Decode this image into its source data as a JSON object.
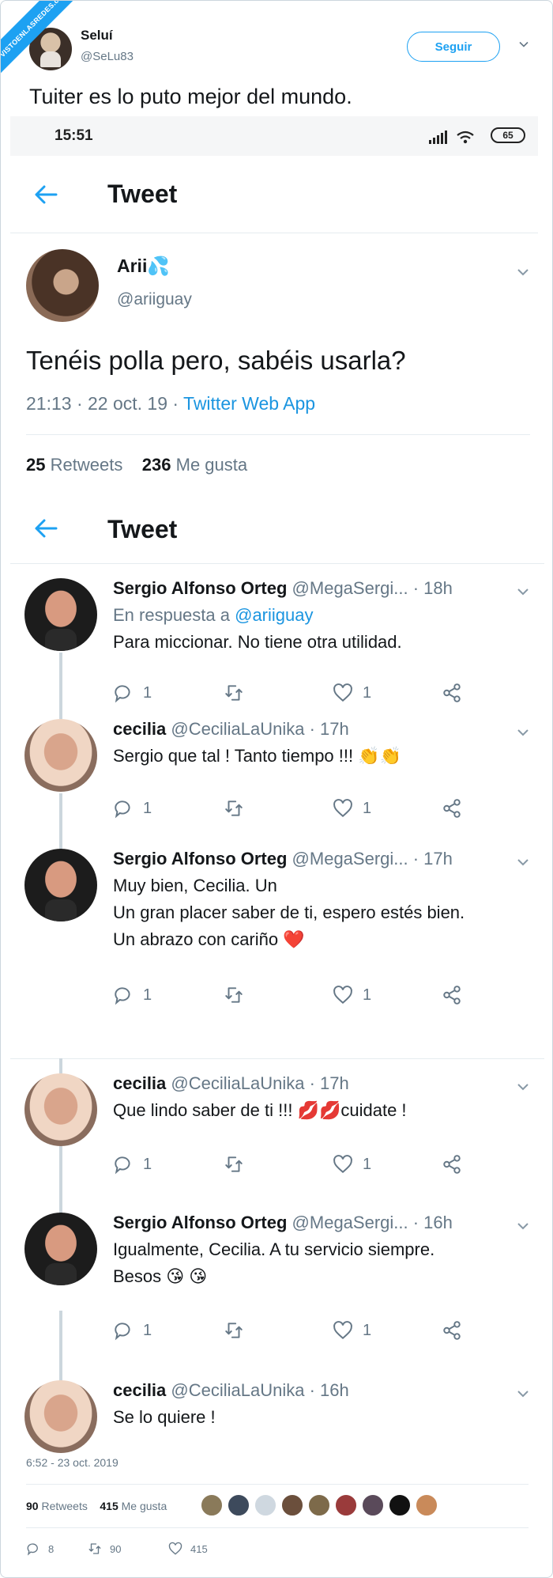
{
  "watermark": "VISTOENLASREDES.com",
  "outer": {
    "author_name": "Seluí",
    "author_handle": "@SeLu83",
    "follow_label": "Seguir",
    "tweet_text": "Tuiter es lo puto mejor del mundo.",
    "timestamp": "6:52 - 23 oct. 2019",
    "retweets_count": "90",
    "retweets_label": "Retweets",
    "likes_count": "415",
    "likes_label": "Me gusta",
    "actions": {
      "replies": "8",
      "retweets": "90",
      "likes": "415"
    },
    "liker_colors": [
      "#8a7a5a",
      "#3d4a5c",
      "#cfd8e0",
      "#6b4f3c",
      "#7d6a4a",
      "#9a3b3b",
      "#5a4a5a",
      "#111111",
      "#c98a5a"
    ]
  },
  "statusbar": {
    "time": "15:51",
    "battery": "65"
  },
  "screen1": {
    "title": "Tweet",
    "tweet": {
      "name": "Arii💦",
      "handle": "@ariiguay",
      "text": "Tenéis polla pero, sabéis usarla?",
      "time_date": "21:13 · 22 oct. 19 · ",
      "app": "Twitter Web App",
      "retweets_count": "25",
      "retweets_label": "Retweets",
      "likes_count": "236",
      "likes_label": "Me gusta"
    }
  },
  "screen2": {
    "title": "Tweet",
    "replies": [
      {
        "name": "Sergio Alfonso Orteg",
        "handle": "@MegaSergi...",
        "time": " · 18h",
        "reply_prefix": "En respuesta a ",
        "reply_to": "@ariiguay",
        "lines": [
          "Para miccionar. No tiene otra utilidad."
        ],
        "counts": {
          "replies": "1",
          "likes": "1"
        }
      },
      {
        "name": "cecilia",
        "handle": "@CeciliaLaUnika",
        "time": " · 17h",
        "lines": [
          "Sergio que tal ! Tanto tiempo !!! 👏👏"
        ],
        "counts": {
          "replies": "1",
          "likes": "1"
        }
      },
      {
        "name": "Sergio Alfonso Orteg",
        "handle": "@MegaSergi...",
        "time": " · 17h",
        "lines": [
          "Muy bien, Cecilia. Un",
          "Un gran placer saber de ti, espero estés bien.",
          "Un abrazo con cariño ❤️"
        ],
        "counts": {
          "replies": "1",
          "likes": "1"
        }
      },
      {
        "name": "cecilia",
        "handle": "@CeciliaLaUnika",
        "time": " · 17h",
        "lines": [
          "Que lindo saber de ti !!! 💋💋cuidate !"
        ],
        "counts": {
          "replies": "1",
          "likes": "1"
        }
      },
      {
        "name": "Sergio Alfonso Orteg",
        "handle": "@MegaSergi...",
        "time": " · 16h",
        "lines": [
          "Igualmente, Cecilia. A tu servicio siempre.",
          "Besos 😘 😘"
        ],
        "counts": {
          "replies": "1",
          "likes": "1"
        }
      },
      {
        "name": "cecilia",
        "handle": "@CeciliaLaUnika",
        "time": " · 16h",
        "lines": [
          "Se lo quiere !"
        ]
      }
    ]
  }
}
